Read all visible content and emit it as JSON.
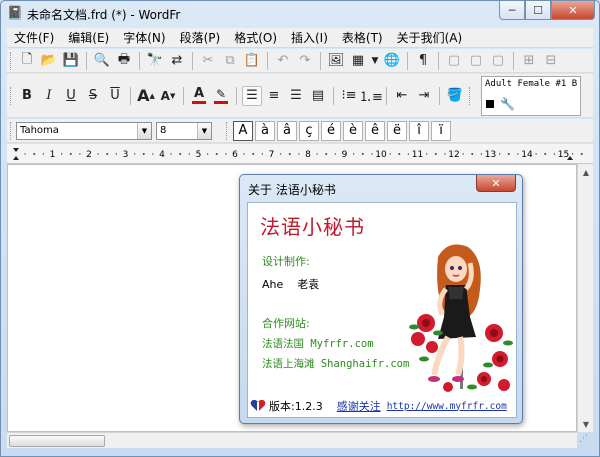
{
  "window": {
    "title": "未命名文档.frd (*) - WordFr",
    "minimize_label": "─",
    "maximize_label": "☐",
    "close_label": "✕"
  },
  "menu": {
    "items": [
      "文件(F)",
      "编辑(E)",
      "字体(N)",
      "段落(P)",
      "格式(O)",
      "插入(I)",
      "表格(T)",
      "关于我们(A)"
    ]
  },
  "toolbar_format": {
    "bold": "B",
    "italic": "I",
    "underline": "U",
    "strike": "S",
    "overline": "U",
    "grow": "A",
    "shrink": "A",
    "font_color_letter": "A",
    "highlight_letter": "✎",
    "font_color": "#d01010",
    "highlight_color": "#d01010"
  },
  "voice_panel": {
    "voice_name": "Adult Female #1 B"
  },
  "font_bar": {
    "font_name": "Tahoma",
    "font_size": "8",
    "special_chars": [
      "A",
      "à",
      "â",
      "ç",
      "é",
      "è",
      "ê",
      "ë",
      "î",
      "ï"
    ]
  },
  "ruler": {
    "labels": [
      "1",
      "2",
      "3",
      "4",
      "5",
      "6",
      "7",
      "8",
      "9",
      "10",
      "11",
      "12",
      "13",
      "14",
      "15"
    ]
  },
  "about_dialog": {
    "title": "关于 法语小秘书",
    "close_label": "✕",
    "app_name": "法语小秘书",
    "design_label": "设计制作:",
    "authors": "Ahe    老袁",
    "partner_label": "合作网站:",
    "partner_1": "法语法国 Myfrfr.com",
    "partner_2": "法语上海滩 Shanghaifr.com",
    "version": "版本:1.2.3",
    "thanks_link": "感谢关注",
    "url": "http://www.myfrfr.com"
  }
}
